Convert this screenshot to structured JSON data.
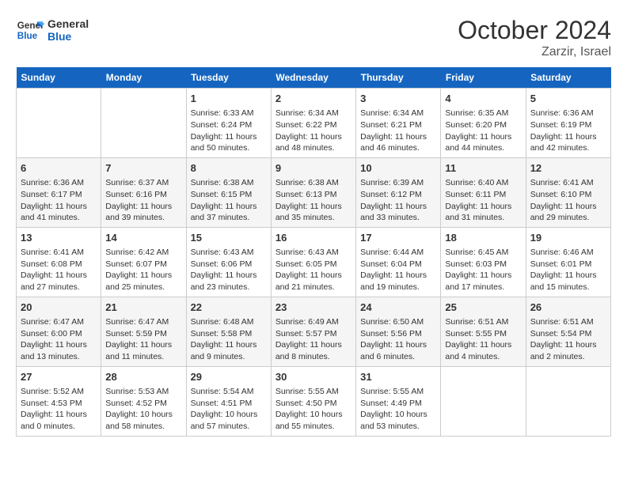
{
  "logo": {
    "line1": "General",
    "line2": "Blue"
  },
  "title": "October 2024",
  "location": "Zarzir, Israel",
  "days_header": [
    "Sunday",
    "Monday",
    "Tuesday",
    "Wednesday",
    "Thursday",
    "Friday",
    "Saturday"
  ],
  "weeks": [
    [
      {
        "day": "",
        "info": ""
      },
      {
        "day": "",
        "info": ""
      },
      {
        "day": "1",
        "info": "Sunrise: 6:33 AM\nSunset: 6:24 PM\nDaylight: 11 hours and 50 minutes."
      },
      {
        "day": "2",
        "info": "Sunrise: 6:34 AM\nSunset: 6:22 PM\nDaylight: 11 hours and 48 minutes."
      },
      {
        "day": "3",
        "info": "Sunrise: 6:34 AM\nSunset: 6:21 PM\nDaylight: 11 hours and 46 minutes."
      },
      {
        "day": "4",
        "info": "Sunrise: 6:35 AM\nSunset: 6:20 PM\nDaylight: 11 hours and 44 minutes."
      },
      {
        "day": "5",
        "info": "Sunrise: 6:36 AM\nSunset: 6:19 PM\nDaylight: 11 hours and 42 minutes."
      }
    ],
    [
      {
        "day": "6",
        "info": "Sunrise: 6:36 AM\nSunset: 6:17 PM\nDaylight: 11 hours and 41 minutes."
      },
      {
        "day": "7",
        "info": "Sunrise: 6:37 AM\nSunset: 6:16 PM\nDaylight: 11 hours and 39 minutes."
      },
      {
        "day": "8",
        "info": "Sunrise: 6:38 AM\nSunset: 6:15 PM\nDaylight: 11 hours and 37 minutes."
      },
      {
        "day": "9",
        "info": "Sunrise: 6:38 AM\nSunset: 6:13 PM\nDaylight: 11 hours and 35 minutes."
      },
      {
        "day": "10",
        "info": "Sunrise: 6:39 AM\nSunset: 6:12 PM\nDaylight: 11 hours and 33 minutes."
      },
      {
        "day": "11",
        "info": "Sunrise: 6:40 AM\nSunset: 6:11 PM\nDaylight: 11 hours and 31 minutes."
      },
      {
        "day": "12",
        "info": "Sunrise: 6:41 AM\nSunset: 6:10 PM\nDaylight: 11 hours and 29 minutes."
      }
    ],
    [
      {
        "day": "13",
        "info": "Sunrise: 6:41 AM\nSunset: 6:08 PM\nDaylight: 11 hours and 27 minutes."
      },
      {
        "day": "14",
        "info": "Sunrise: 6:42 AM\nSunset: 6:07 PM\nDaylight: 11 hours and 25 minutes."
      },
      {
        "day": "15",
        "info": "Sunrise: 6:43 AM\nSunset: 6:06 PM\nDaylight: 11 hours and 23 minutes."
      },
      {
        "day": "16",
        "info": "Sunrise: 6:43 AM\nSunset: 6:05 PM\nDaylight: 11 hours and 21 minutes."
      },
      {
        "day": "17",
        "info": "Sunrise: 6:44 AM\nSunset: 6:04 PM\nDaylight: 11 hours and 19 minutes."
      },
      {
        "day": "18",
        "info": "Sunrise: 6:45 AM\nSunset: 6:03 PM\nDaylight: 11 hours and 17 minutes."
      },
      {
        "day": "19",
        "info": "Sunrise: 6:46 AM\nSunset: 6:01 PM\nDaylight: 11 hours and 15 minutes."
      }
    ],
    [
      {
        "day": "20",
        "info": "Sunrise: 6:47 AM\nSunset: 6:00 PM\nDaylight: 11 hours and 13 minutes."
      },
      {
        "day": "21",
        "info": "Sunrise: 6:47 AM\nSunset: 5:59 PM\nDaylight: 11 hours and 11 minutes."
      },
      {
        "day": "22",
        "info": "Sunrise: 6:48 AM\nSunset: 5:58 PM\nDaylight: 11 hours and 9 minutes."
      },
      {
        "day": "23",
        "info": "Sunrise: 6:49 AM\nSunset: 5:57 PM\nDaylight: 11 hours and 8 minutes."
      },
      {
        "day": "24",
        "info": "Sunrise: 6:50 AM\nSunset: 5:56 PM\nDaylight: 11 hours and 6 minutes."
      },
      {
        "day": "25",
        "info": "Sunrise: 6:51 AM\nSunset: 5:55 PM\nDaylight: 11 hours and 4 minutes."
      },
      {
        "day": "26",
        "info": "Sunrise: 6:51 AM\nSunset: 5:54 PM\nDaylight: 11 hours and 2 minutes."
      }
    ],
    [
      {
        "day": "27",
        "info": "Sunrise: 5:52 AM\nSunset: 4:53 PM\nDaylight: 11 hours and 0 minutes."
      },
      {
        "day": "28",
        "info": "Sunrise: 5:53 AM\nSunset: 4:52 PM\nDaylight: 10 hours and 58 minutes."
      },
      {
        "day": "29",
        "info": "Sunrise: 5:54 AM\nSunset: 4:51 PM\nDaylight: 10 hours and 57 minutes."
      },
      {
        "day": "30",
        "info": "Sunrise: 5:55 AM\nSunset: 4:50 PM\nDaylight: 10 hours and 55 minutes."
      },
      {
        "day": "31",
        "info": "Sunrise: 5:55 AM\nSunset: 4:49 PM\nDaylight: 10 hours and 53 minutes."
      },
      {
        "day": "",
        "info": ""
      },
      {
        "day": "",
        "info": ""
      }
    ]
  ]
}
